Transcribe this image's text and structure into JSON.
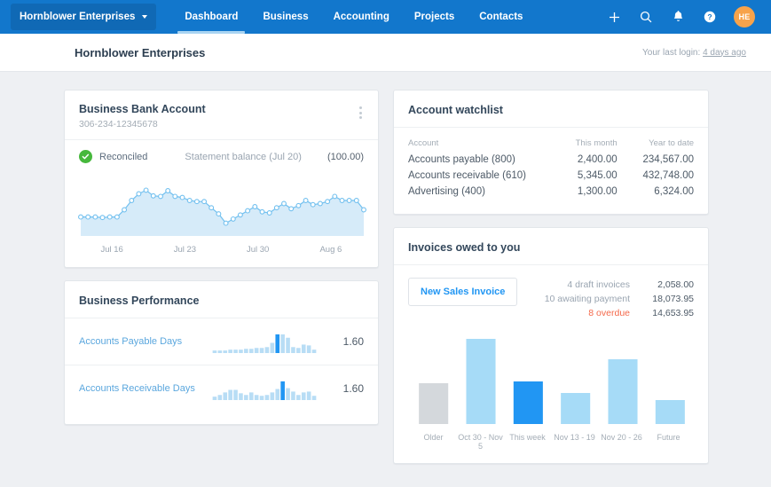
{
  "nav": {
    "org_name": "Hornblower Enterprises",
    "links": [
      {
        "label": "Dashboard",
        "active": true
      },
      {
        "label": "Business",
        "active": false
      },
      {
        "label": "Accounting",
        "active": false
      },
      {
        "label": "Projects",
        "active": false
      },
      {
        "label": "Contacts",
        "active": false
      }
    ],
    "icons": [
      "plus-icon",
      "search-icon",
      "bell-icon",
      "help-icon"
    ],
    "avatar_initials": "HE",
    "avatar_color": "#f7a34b",
    "bar_color": "#1277cc"
  },
  "header": {
    "title": "Hornblower Enterprises",
    "last_login_prefix": "Your last login: ",
    "last_login_link": "4 days ago"
  },
  "bank_card": {
    "title": "Business Bank Account",
    "account_number": "306-234-12345678",
    "status": "Reconciled",
    "status_color": "#46b83c",
    "statement_label": "Statement balance (Jul 20)",
    "statement_value": "(100.00)",
    "chart_data": {
      "type": "area",
      "title": "Business Bank Account balance",
      "xlabel": "",
      "ylabel": "",
      "grid": false,
      "legend": "none",
      "line_color": "#72c0ef",
      "fill_color": "#cfe8f8",
      "tick_labels": [
        "Jul 16",
        "Jul 23",
        "Jul 30",
        "Aug 6"
      ],
      "x": [
        0,
        1,
        2,
        3,
        4,
        5,
        6,
        7,
        8,
        9,
        10,
        11,
        12,
        13,
        14,
        15,
        16,
        17,
        18,
        19,
        20,
        21,
        22,
        23,
        24,
        25,
        26,
        27,
        28,
        29,
        30,
        31,
        32,
        33,
        34,
        35,
        36,
        37,
        38,
        39
      ],
      "values": [
        30,
        30,
        30,
        29,
        30,
        30,
        44,
        62,
        75,
        82,
        71,
        70,
        81,
        70,
        68,
        62,
        60,
        60,
        48,
        36,
        18,
        26,
        34,
        42,
        50,
        40,
        38,
        48,
        56,
        46,
        52,
        62,
        54,
        56,
        60,
        70,
        62,
        62,
        62,
        44
      ],
      "ylim": [
        0,
        100
      ]
    }
  },
  "performance_card": {
    "title": "Business Performance",
    "rows": [
      {
        "label": "Accounts Payable Days",
        "value": "1.60",
        "chart_data": {
          "type": "bar",
          "title": "Accounts Payable Days",
          "bar_color": "#b8ddf5",
          "highlight_color": "#2196f3",
          "highlight_index": 12,
          "values": [
            3,
            3,
            3,
            4,
            4,
            4,
            5,
            5,
            6,
            6,
            7,
            12,
            22,
            22,
            18,
            7,
            6,
            10,
            9,
            4
          ],
          "ylim": [
            0,
            24
          ]
        }
      },
      {
        "label": "Accounts Receivable Days",
        "value": "1.60",
        "chart_data": {
          "type": "bar",
          "title": "Accounts Receivable Days",
          "bar_color": "#b8ddf5",
          "highlight_color": "#2196f3",
          "highlight_index": 13,
          "values": [
            4,
            6,
            9,
            12,
            12,
            8,
            6,
            9,
            6,
            5,
            6,
            9,
            13,
            22,
            14,
            10,
            6,
            9,
            10,
            5
          ],
          "ylim": [
            0,
            24
          ]
        }
      }
    ]
  },
  "watchlist_card": {
    "title": "Account watchlist",
    "columns": [
      "Account",
      "This month",
      "Year to date"
    ],
    "rows": [
      {
        "account": "Accounts payable (800)",
        "this_month": "2,400.00",
        "ytd": "234,567.00"
      },
      {
        "account": "Accounts receivable (610)",
        "this_month": "5,345.00",
        "ytd": "432,748.00"
      },
      {
        "account": "Advertising (400)",
        "this_month": "1,300.00",
        "ytd": "6,324.00"
      }
    ]
  },
  "invoices_card": {
    "title": "Invoices owed to you",
    "new_invoice_button": "New Sales Invoice",
    "summary": [
      {
        "label": "4 draft invoices",
        "amount": "2,058.00",
        "overdue": false
      },
      {
        "label": "10 awaiting payment",
        "amount": "18,073.95",
        "overdue": false
      },
      {
        "label": "8 overdue",
        "amount": "14,653.95",
        "overdue": true
      }
    ],
    "overdue_color": "#f4694b",
    "chart_data": {
      "type": "bar",
      "title": "Invoices owed to you",
      "xlabel": "",
      "ylabel": "",
      "grid": false,
      "legend": "none",
      "categories": [
        "Older",
        "Oct 30 - Nov 5",
        "This week",
        "Nov 13 - 19",
        "Nov 20 - 26",
        "Future"
      ],
      "values": [
        46,
        96,
        48,
        35,
        73,
        27
      ],
      "bar_colors": [
        "#d4d8dc",
        "#a6dbf7",
        "#2196f3",
        "#a6dbf7",
        "#a6dbf7",
        "#a6dbf7"
      ],
      "highlight_index": 2,
      "ylim": [
        0,
        100
      ]
    }
  }
}
